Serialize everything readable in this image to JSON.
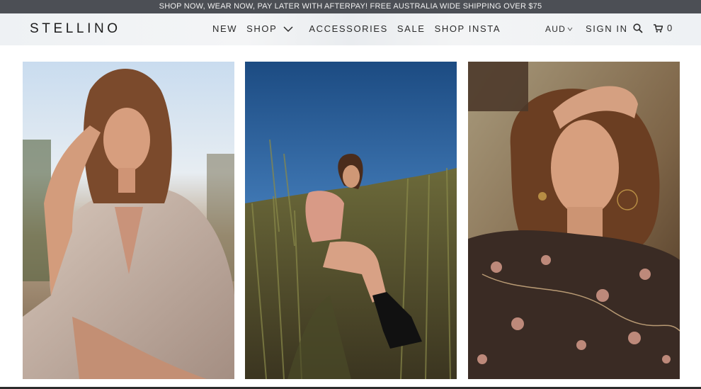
{
  "promo": {
    "text": "SHOP NOW, WEAR NOW, PAY LATER WITH AFTERPAY! FREE AUSTRALIA WIDE SHIPPING OVER $75"
  },
  "header": {
    "logo": "STELLINO",
    "nav": {
      "new": "NEW",
      "shop": "SHOP",
      "accessories": "ACCESSORIES",
      "sale": "SALE",
      "shop_insta": "SHOP INSTA"
    },
    "currency": "AUD",
    "sign_in": "SIGN IN",
    "cart_count": "0",
    "icons": {
      "search": "search-icon",
      "cart": "shopping-cart-icon",
      "dropdown": "chevron-down-icon"
    }
  },
  "gallery": {
    "images": [
      {
        "name": "model-pleated-jacket-photo"
      },
      {
        "name": "model-grass-field-photo"
      },
      {
        "name": "model-embroidered-top-photo"
      }
    ]
  },
  "colors": {
    "promo_bg": "#4c4f55",
    "header_bg": "#eef1f4",
    "text": "#2a2a2a",
    "sky_blue": "#1f4f86"
  }
}
